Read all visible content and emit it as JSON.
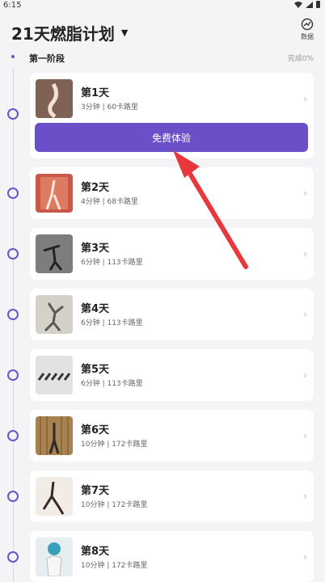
{
  "status_bar": {
    "time": "6:15"
  },
  "header": {
    "plan_title": "21天燃脂计划",
    "data_label": "数据"
  },
  "stage": {
    "label": "第一阶段",
    "progress": "完成0%"
  },
  "trial_button": "免费体验",
  "days": [
    {
      "title": "第1天",
      "meta": "3分钟 | 60卡路里",
      "thumb_color": "#5a3a30"
    },
    {
      "title": "第2天",
      "meta": "4分钟 | 68卡路里",
      "thumb_color": "#c04a3a"
    },
    {
      "title": "第3天",
      "meta": "6分钟 | 113卡路里",
      "thumb_color": "#8a8a8a"
    },
    {
      "title": "第4天",
      "meta": "6分钟 | 113卡路里",
      "thumb_color": "#c8c8c0"
    },
    {
      "title": "第5天",
      "meta": "6分钟 | 113卡路里",
      "thumb_color": "#d8d8d8"
    },
    {
      "title": "第6天",
      "meta": "10分钟 | 172卡路里",
      "thumb_color": "#b08a5a"
    },
    {
      "title": "第7天",
      "meta": "10分钟 | 172卡路里",
      "thumb_color": "#e8e0d8"
    },
    {
      "title": "第8天",
      "meta": "10分钟 | 172卡路里",
      "thumb_color": "#dde6ea"
    }
  ],
  "colors": {
    "accent": "#6a4fc9",
    "arrow": "#e8383d"
  }
}
